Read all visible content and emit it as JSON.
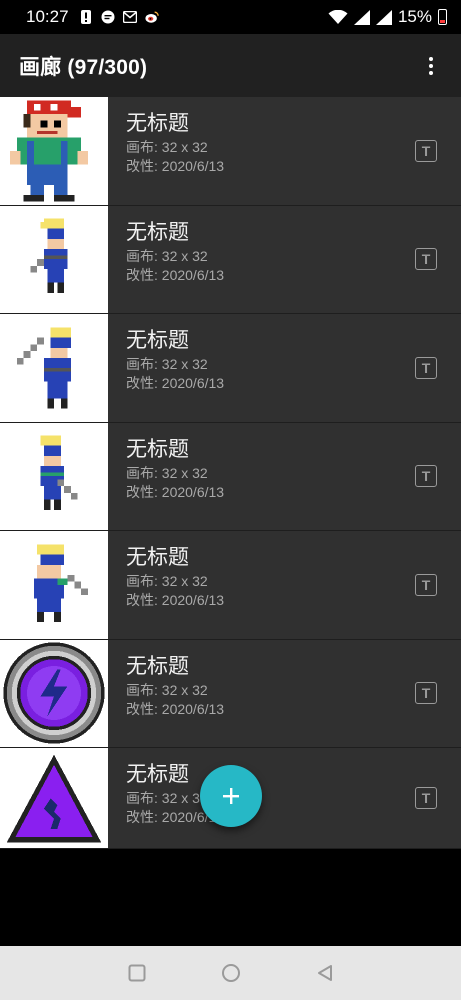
{
  "status_bar": {
    "time": "10:27",
    "battery_percent": "15%",
    "icons": [
      "alert-icon",
      "messenger-icon",
      "mail-icon",
      "weibo-icon",
      "wifi-icon",
      "signal-icon",
      "signal-icon",
      "battery-icon"
    ]
  },
  "app_bar": {
    "title": "画廊 (97/300)",
    "menu_icon": "more-vert-icon"
  },
  "gallery": {
    "items": [
      {
        "title": "无标题",
        "canvas": "画布: 32 x 32",
        "modified": "改性: 2020/6/13",
        "thumbnail": "pirate-boy-sprite"
      },
      {
        "title": "无标题",
        "canvas": "画布: 32 x 32",
        "modified": "改性: 2020/6/13",
        "thumbnail": "swordsman-sprite-small"
      },
      {
        "title": "无标题",
        "canvas": "画布: 32 x 32",
        "modified": "改性: 2020/6/13",
        "thumbnail": "swordsman-sprite-raised"
      },
      {
        "title": "无标题",
        "canvas": "画布: 32 x 32",
        "modified": "改性: 2020/6/13",
        "thumbnail": "swordsman-sprite-side"
      },
      {
        "title": "无标题",
        "canvas": "画布: 32 x 32",
        "modified": "改性: 2020/6/13",
        "thumbnail": "swordsman-sprite-front"
      },
      {
        "title": "无标题",
        "canvas": "画布: 32 x 32",
        "modified": "改性: 2020/6/13",
        "thumbnail": "lightning-badge"
      },
      {
        "title": "无标题",
        "canvas": "画布: 32 x 3",
        "modified": "改性: 2020/6/1",
        "thumbnail": "purple-triangle-sign"
      }
    ],
    "rename_icon": "text-t-icon"
  },
  "fab": {
    "icon": "plus-icon",
    "color": "#26b8c6"
  },
  "nav_bar": {
    "buttons": [
      "recents-square-icon",
      "home-circle-icon",
      "back-triangle-icon"
    ]
  },
  "colors": {
    "app_bar": "#212121",
    "list_item": "#303030",
    "accent": "#26b8c6"
  }
}
